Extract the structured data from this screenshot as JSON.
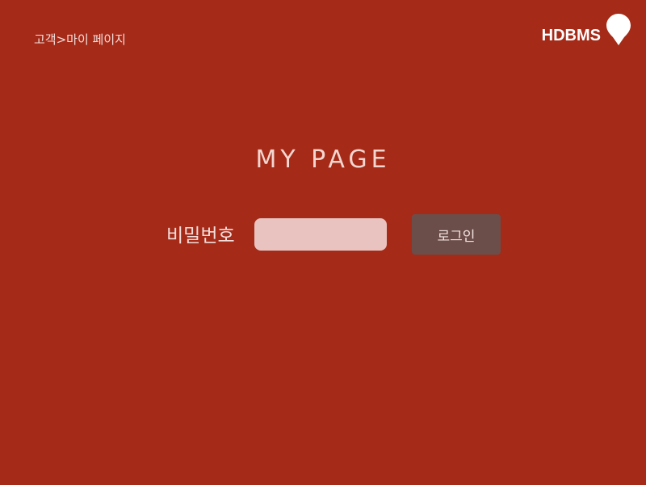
{
  "breadcrumb": {
    "text": "고객>마이 페이지"
  },
  "brand": {
    "name": "HDBMS",
    "icon": "map-pin-icon"
  },
  "main": {
    "title": "MY PAGE",
    "password_label": "비밀번호",
    "password_value": "",
    "password_placeholder": "",
    "login_label": "로그인"
  },
  "colors": {
    "background": "#a52a18",
    "input_background": "#e8c3bf",
    "button_background": "#6b4e4a",
    "text": "#ffffff"
  }
}
